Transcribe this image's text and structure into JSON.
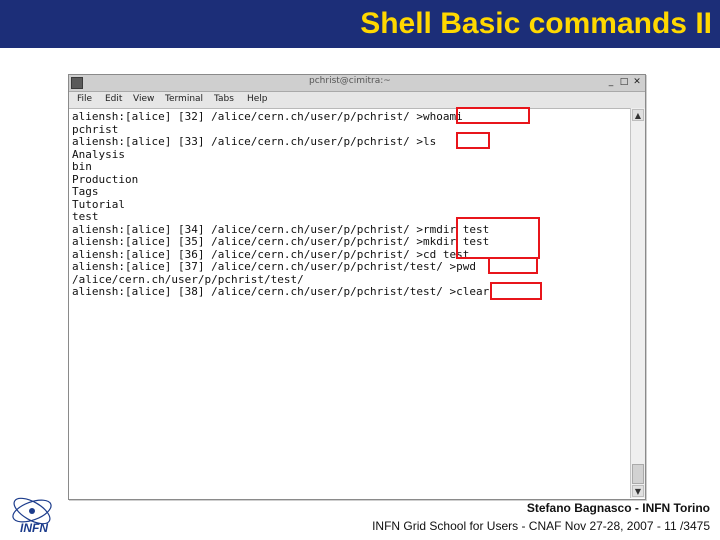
{
  "slide": {
    "title": "Shell Basic commands II",
    "footer_author": "Stefano Bagnasco - INFN Torino",
    "footer_event": "INFN Grid School for Users - CNAF Nov 27-28, 2007 - 11 /3475",
    "logo_text": "INFN",
    "colors": {
      "title_bar": "#1c2e78",
      "title_text": "#ffd800",
      "highlight": "#e8151b"
    }
  },
  "window": {
    "title": "pchrist@cimitra:~",
    "minimize_label": "_",
    "maximize_label": "□",
    "close_label": "✕",
    "menu": [
      "File",
      "Edit",
      "View",
      "Terminal",
      "Tabs",
      "Help"
    ],
    "scroll_up_label": "▲",
    "scroll_down_label": "▼"
  },
  "terminal": {
    "lines": [
      "aliensh:[alice] [32] /alice/cern.ch/user/p/pchrist/ >whoami",
      "pchrist",
      "aliensh:[alice] [33] /alice/cern.ch/user/p/pchrist/ >ls",
      "Analysis",
      "bin",
      "Production",
      "Tags",
      "Tutorial",
      "test",
      "aliensh:[alice] [34] /alice/cern.ch/user/p/pchrist/ >rmdir test",
      "aliensh:[alice] [35] /alice/cern.ch/user/p/pchrist/ >mkdir test",
      "aliensh:[alice] [36] /alice/cern.ch/user/p/pchrist/ >cd test",
      "aliensh:[alice] [37] /alice/cern.ch/user/p/pchrist/test/ >pwd",
      "/alice/cern.ch/user/p/pchrist/test/",
      "aliensh:[alice] [38] /alice/cern.ch/user/p/pchrist/test/ >clear"
    ]
  }
}
